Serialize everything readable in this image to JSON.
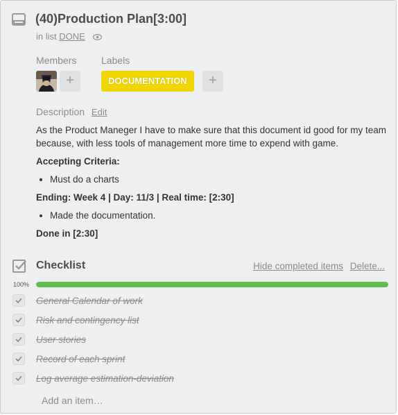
{
  "card": {
    "title": "(40)Production Plan[3:00]",
    "in_list_prefix": "in list",
    "list_name": "DONE"
  },
  "members": {
    "label": "Members",
    "add": "+"
  },
  "labels": {
    "label": "Labels",
    "items": [
      "DOCUMENTATION"
    ],
    "label_color": "#f2d600",
    "add": "+"
  },
  "description": {
    "label": "Description",
    "edit": "Edit",
    "text": "As the Product Maneger I have to make sure that this document id good for my team because, with less tools of management more time to expend with game.",
    "criteria_heading": "Accepting Criteria:",
    "criteria_item": "Must do a charts",
    "ending": "Ending: Week 4 | Day: 11/3 | Real time: [2:30]",
    "ending_item": "Made the documentation.",
    "done": "Done in [2:30]"
  },
  "checklist": {
    "title": "Checklist",
    "hide_completed": "Hide completed items",
    "delete": "Delete...",
    "progress_label": "100%",
    "progress": 1.0,
    "progress_color": "#61bd4f",
    "items": [
      "General Calendar of work",
      "Risk and contingency list",
      "User stories",
      "Record of each sprint",
      "Log average estimation-deviation"
    ],
    "add_item": "Add an item…"
  }
}
